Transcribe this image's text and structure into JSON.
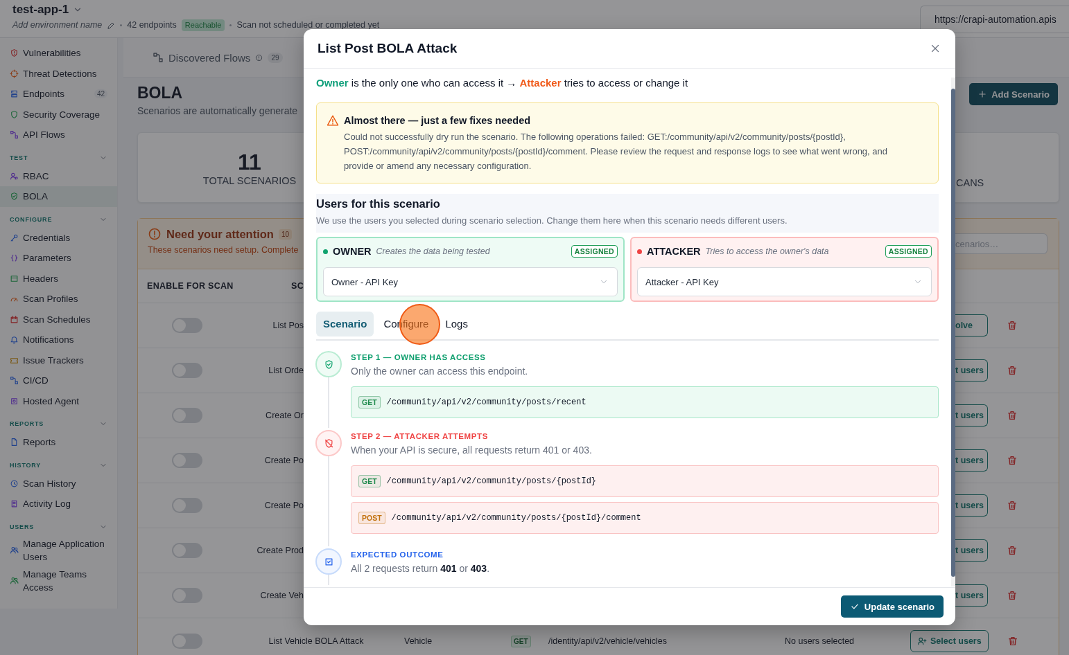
{
  "header": {
    "app_name": "test-app-1",
    "environment_placeholder": "Add environment name",
    "endpoints": "42 endpoints",
    "status": "Reachable",
    "scan_status": "Scan not scheduled or completed yet",
    "url": "https://crapi-automation.apis"
  },
  "sidebar": {
    "sections": [
      {
        "items": [
          {
            "label": "Vulnerabilities",
            "selected": false
          },
          {
            "label": "Threat Detections",
            "selected": false
          },
          {
            "label": "Endpoints",
            "count": "42",
            "selected": false
          },
          {
            "label": "Security Coverage",
            "selected": false
          },
          {
            "label": "API Flows",
            "selected": false
          }
        ]
      },
      {
        "label": "TEST",
        "items": [
          {
            "label": "RBAC",
            "selected": false
          },
          {
            "label": "BOLA",
            "selected": true
          }
        ]
      },
      {
        "label": "CONFIGURE",
        "items": [
          {
            "label": "Credentials",
            "selected": false
          },
          {
            "label": "Parameters",
            "selected": false
          },
          {
            "label": "Headers",
            "selected": false
          },
          {
            "label": "Scan Profiles",
            "selected": false
          },
          {
            "label": "Scan Schedules",
            "selected": false
          },
          {
            "label": "Notifications",
            "selected": false
          },
          {
            "label": "Issue Trackers",
            "selected": false
          },
          {
            "label": "CI/CD",
            "selected": false
          },
          {
            "label": "Hosted Agent",
            "selected": false
          }
        ]
      },
      {
        "label": "REPORTS",
        "items": [
          {
            "label": "Reports",
            "selected": false
          }
        ]
      },
      {
        "label": "HISTORY",
        "items": [
          {
            "label": "Scan History",
            "selected": false
          },
          {
            "label": "Activity Log",
            "selected": false
          }
        ]
      },
      {
        "label": "USERS",
        "items": [
          {
            "label": "Manage Application Users",
            "selected": false
          },
          {
            "label": "Manage Teams Access",
            "selected": false
          }
        ]
      }
    ]
  },
  "page": {
    "tab": {
      "label": "Discovered Flows",
      "count": "29"
    },
    "title": "BOLA",
    "subtitle": "Scenarios are automatically generate",
    "add_button": "Add Scenario",
    "stats": {
      "total_value": "11",
      "total_label": "TOTAL SCENARIOS",
      "column_2_label": "CANS"
    },
    "attention": {
      "title": "Need your attention",
      "count": "10",
      "subtitle": "These scenarios need setup. Complete",
      "search_placeholder": "cenarios…",
      "columns": [
        "ENABLE FOR SCAN",
        "SC"
      ],
      "rows": [
        {
          "kind": "covered",
          "enabled": false,
          "name": "List Pos",
          "action": "olve"
        },
        {
          "kind": "covered",
          "enabled": false,
          "name": "List Orde",
          "action": "t users"
        },
        {
          "kind": "covered",
          "enabled": false,
          "name": "Create Or",
          "action": "t users"
        },
        {
          "kind": "covered",
          "enabled": false,
          "name": "Create Po",
          "action": "t users"
        },
        {
          "kind": "covered",
          "enabled": false,
          "name": "Create Po",
          "action": "t users"
        },
        {
          "kind": "covered",
          "enabled": false,
          "name": "Create Prod",
          "action": "t users"
        },
        {
          "kind": "covered",
          "enabled": false,
          "name": "Create Veh",
          "action": "t users"
        },
        {
          "kind": "full",
          "enabled": false,
          "name": "List Vehicle BOLA Attack",
          "category": "Vehicle",
          "method": "GET",
          "path": "/identity/api/v2/vehicle/vehicles",
          "users": "No users selected",
          "action": "Select users"
        }
      ]
    }
  },
  "modal": {
    "title": "List Post BOLA Attack",
    "summary": {
      "owner": "Owner",
      "middle": "is the only one who can access it →",
      "attacker": "Attacker",
      "end": "tries to access or change it"
    },
    "warning": {
      "title": "Almost there — just a few fixes needed",
      "text": "Could not successfully dry run the scenario. The following operations failed: GET:/community/api/v2/community/posts/{postId}, POST:/community/api/v2/community/posts/{postId}/comment. Please review the request and response logs to see what went wrong, and provide or amend any necessary configuration."
    },
    "users": {
      "title": "Users for this scenario",
      "description": "We use the users you selected during scenario selection. Change them here when this scenario needs different users.",
      "roles": [
        {
          "kind": "owner",
          "label": "OWNER",
          "description": "Creates the data being tested",
          "badge": "ASSIGNED",
          "value": "Owner - API Key"
        },
        {
          "kind": "attacker",
          "label": "ATTACKER",
          "description": "Tries to access the owner's data",
          "badge": "ASSIGNED",
          "value": "Attacker - API Key"
        }
      ]
    },
    "tabs": [
      {
        "label": "Scenario",
        "selected": true
      },
      {
        "label": "Configure",
        "selected": false
      },
      {
        "label": "Logs",
        "selected": false
      }
    ],
    "steps": [
      {
        "kind": "owner",
        "title": "STEP 1 — OWNER HAS ACCESS",
        "description": "Only the owner can access this endpoint.",
        "requests": [
          {
            "method": "GET",
            "color": "#1f8a4c",
            "path": "/community/api/v2/community/posts/recent"
          }
        ]
      },
      {
        "kind": "attacker",
        "title": "STEP 2 — ATTACKER ATTEMPTS",
        "description": "When your API is secure, all requests return 401 or 403.",
        "requests": [
          {
            "method": "GET",
            "color": "#1f8a4c",
            "path": "/community/api/v2/community/posts/{postId}"
          },
          {
            "method": "POST",
            "color": "#c2710c",
            "path": "/community/api/v2/community/posts/{postId}/comment"
          }
        ]
      },
      {
        "kind": "outcome",
        "title": "EXPECTED OUTCOME",
        "description": "All 2 requests return **401** or **403**."
      }
    ],
    "submit": "Update scenario"
  }
}
